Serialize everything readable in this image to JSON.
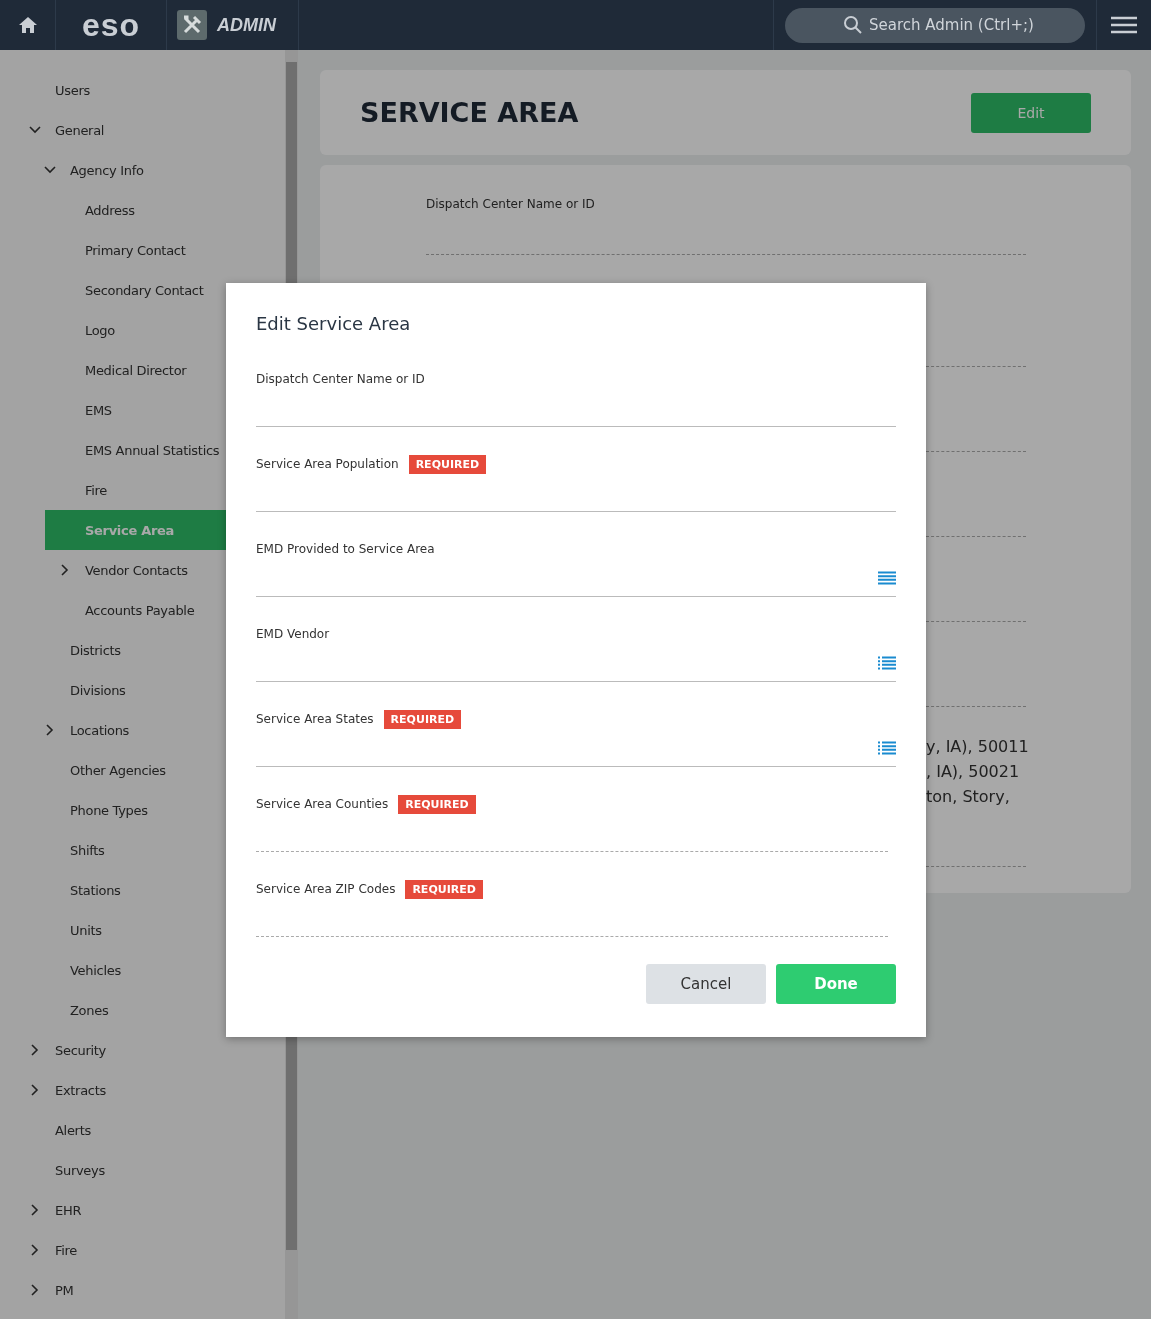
{
  "topbar": {
    "logo": "eso",
    "app_name": "ADMIN",
    "search": {
      "placeholder": "Search Admin (Ctrl+;)"
    }
  },
  "sidebar": {
    "items": [
      {
        "label": "Users",
        "selected": false
      },
      {
        "label": "General",
        "selected": false,
        "expanded": true,
        "children": [
          {
            "label": "Agency Info",
            "selected": false,
            "expanded": true,
            "children": [
              {
                "label": "Address",
                "selected": false
              },
              {
                "label": "Primary Contact",
                "selected": false
              },
              {
                "label": "Secondary Contact",
                "selected": false
              },
              {
                "label": "Logo",
                "selected": false
              },
              {
                "label": "Medical Director",
                "selected": false
              },
              {
                "label": "EMS",
                "selected": false
              },
              {
                "label": "EMS Annual Statistics",
                "selected": false
              },
              {
                "label": "Fire",
                "selected": false
              },
              {
                "label": "Service Area",
                "selected": true
              },
              {
                "label": "Vendor Contacts",
                "selected": false,
                "expanded": false
              },
              {
                "label": "Accounts Payable",
                "selected": false
              }
            ]
          },
          {
            "label": "Districts",
            "selected": false
          },
          {
            "label": "Divisions",
            "selected": false
          },
          {
            "label": "Locations",
            "selected": false,
            "expanded": false
          },
          {
            "label": "Other Agencies",
            "selected": false
          },
          {
            "label": "Phone Types",
            "selected": false
          },
          {
            "label": "Shifts",
            "selected": false
          },
          {
            "label": "Stations",
            "selected": false
          },
          {
            "label": "Units",
            "selected": false
          },
          {
            "label": "Vehicles",
            "selected": false
          },
          {
            "label": "Zones",
            "selected": false
          }
        ]
      },
      {
        "label": "Security",
        "selected": false,
        "expanded": false
      },
      {
        "label": "Extracts",
        "selected": false,
        "expanded": false
      },
      {
        "label": "Alerts",
        "selected": false
      },
      {
        "label": "Surveys",
        "selected": false
      },
      {
        "label": "EHR",
        "selected": false,
        "expanded": false
      },
      {
        "label": "Fire",
        "selected": false,
        "expanded": false
      },
      {
        "label": "PM",
        "selected": false,
        "expanded": false
      }
    ]
  },
  "page": {
    "title": "SERVICE AREA",
    "edit_button": "Edit",
    "fields": [
      {
        "label": "Dispatch Center Name or ID"
      }
    ],
    "value_lines": [
      "y, IA), 50011",
      ", IA), 50021",
      "ton, Story,"
    ]
  },
  "dialog": {
    "title": "Edit Service Area",
    "fields": [
      {
        "label": "Dispatch Center Name or ID",
        "kind": "text"
      },
      {
        "label": "Service Area Population",
        "badge": "REQUIRED",
        "kind": "text"
      },
      {
        "label": "EMD Provided to Service Area",
        "kind": "select"
      },
      {
        "label": "EMD Vendor",
        "kind": "picklist"
      },
      {
        "label": "Service Area States",
        "badge": "REQUIRED",
        "kind": "picklist"
      },
      {
        "label": "Service Area Counties",
        "badge": "REQUIRED",
        "kind": "multi"
      },
      {
        "label": "Service Area ZIP Codes",
        "badge": "REQUIRED",
        "kind": "multi"
      }
    ],
    "buttons": [
      {
        "label": "Cancel",
        "kind": "secondary"
      },
      {
        "label": "Done",
        "kind": "primary"
      }
    ]
  }
}
